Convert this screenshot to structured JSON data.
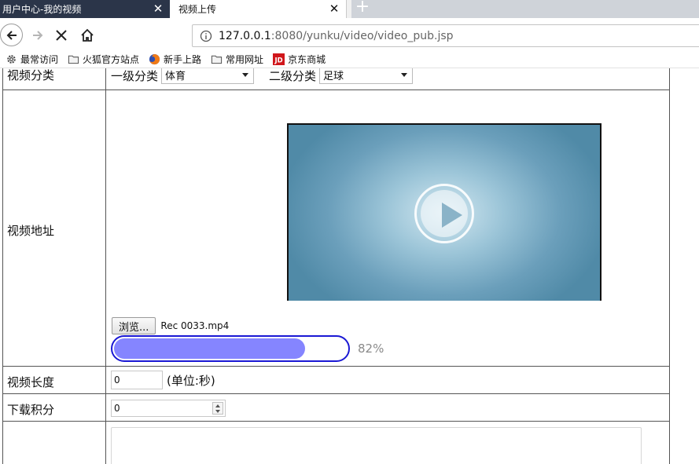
{
  "browser": {
    "tabs": [
      {
        "title": "用户中心-我的视频",
        "active": false
      },
      {
        "title": "视频上传",
        "active": true
      }
    ],
    "url_host": "127.0.0.1",
    "url_rest": ":8080/yunku/video/video_pub.jsp",
    "bookmarks": [
      {
        "label": "最常访问",
        "icon": "gear-icon"
      },
      {
        "label": "火狐官方站点",
        "icon": "folder-icon"
      },
      {
        "label": "新手上路",
        "icon": "firefox-icon"
      },
      {
        "label": "常用网址",
        "icon": "folder-icon"
      },
      {
        "label": "京东商城",
        "icon": "jd-icon"
      }
    ]
  },
  "form": {
    "category": {
      "label": "视频分类",
      "level1_label": "一级分类",
      "level1_value": "体育",
      "level2_label": "二级分类",
      "level2_value": "足球"
    },
    "address": {
      "label": "视频地址",
      "browse_label": "浏览...",
      "file_name": "Rec 0033.mp4",
      "progress_percent": 82,
      "progress_text": "82%"
    },
    "length": {
      "label": "视频长度",
      "value": "0",
      "unit": "(单位:秒)"
    },
    "points": {
      "label": "下载积分",
      "value": "0"
    }
  },
  "colors": {
    "progress_fill": "#8585ff",
    "progress_border": "#1a18d4",
    "inactive_tab": "#2b3549"
  }
}
